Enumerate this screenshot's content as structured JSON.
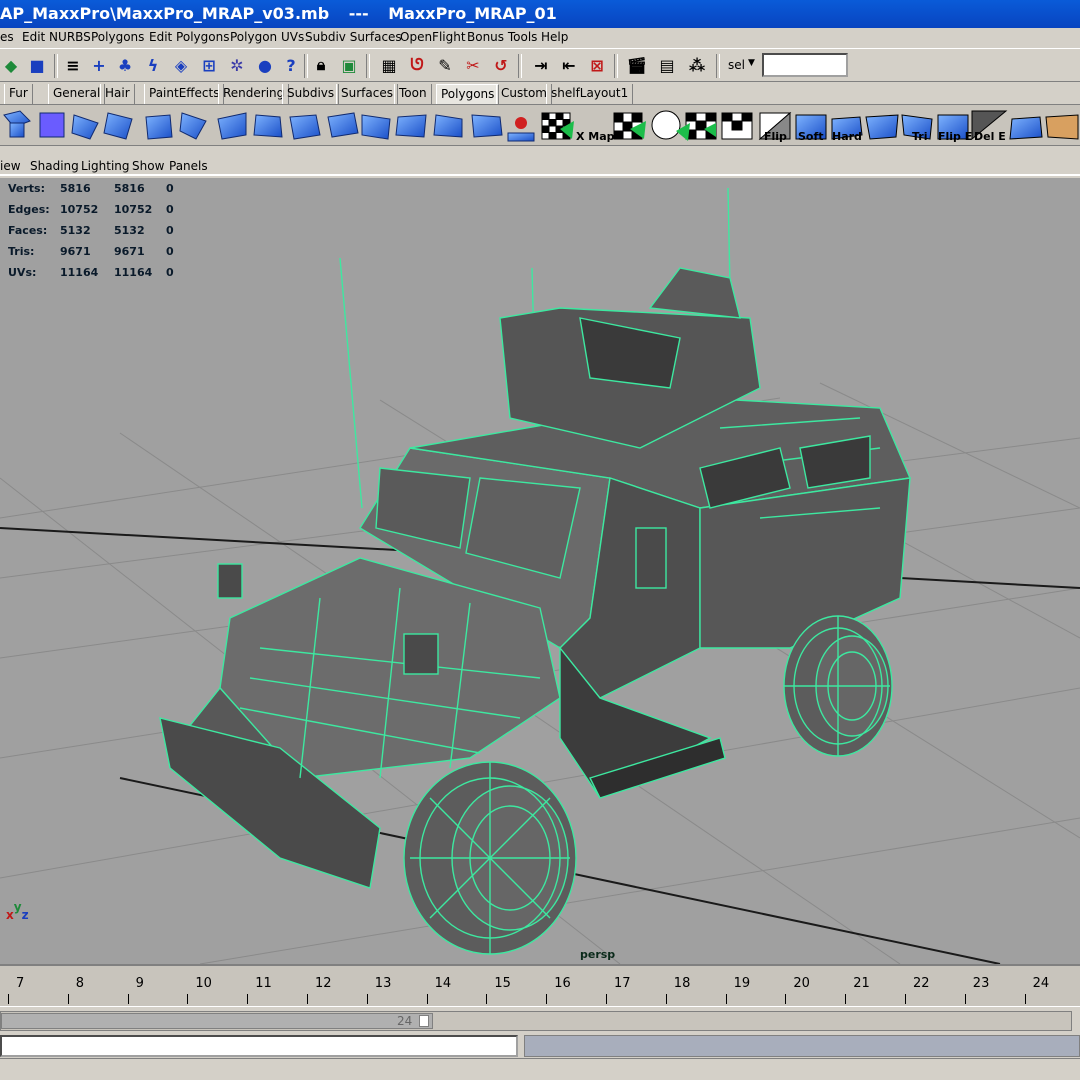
{
  "window": {
    "title_file": "AP_MaxxPro\\MaxxPro_MRAP_v03.mb",
    "title_sep": "---",
    "title_scene": "MaxxPro_MRAP_01"
  },
  "menubar": [
    "es",
    "Edit NURBS",
    "Polygons",
    "Edit Polygons",
    "Polygon UVs",
    "Subdiv Surfaces",
    "OpenFlight",
    "Bonus Tools",
    "Help"
  ],
  "statusline": {
    "sel_label": "sel",
    "sel_value": ""
  },
  "shelf_tabs": [
    "Fur",
    "General",
    "Hair",
    "PaintEffects",
    "Rendering",
    "Subdivs",
    "Surfaces",
    "Toon",
    "Polygons",
    "Custom",
    "shelfLayout1"
  ],
  "shelf_active_tab": "Polygons",
  "shelf_labels": {
    "xmap": "X Map",
    "flip": "Flip",
    "soft": "Soft",
    "hard": "Hard",
    "tri": "Tri",
    "flipe": "Flip E",
    "dele": "Del E"
  },
  "panel_menu": [
    "iew",
    "Shading",
    "Lighting",
    "Show",
    "Panels"
  ],
  "hud": {
    "rows": [
      {
        "label": "Verts:",
        "a": "5816",
        "b": "5816",
        "c": "0"
      },
      {
        "label": "Edges:",
        "a": "10752",
        "b": "10752",
        "c": "0"
      },
      {
        "label": "Faces:",
        "a": "5132",
        "b": "5132",
        "c": "0"
      },
      {
        "label": "Tris:",
        "a": "9671",
        "b": "9671",
        "c": "0"
      },
      {
        "label": "UVs:",
        "a": "11164",
        "b": "11164",
        "c": "0"
      }
    ]
  },
  "viewport": {
    "camera": "persp",
    "axis_x": "x",
    "axis_y": "y",
    "axis_z": "z",
    "wire_color": "#3de8a0",
    "bg_color": "#a0a0a0"
  },
  "timeline": {
    "frames": [
      "7",
      "8",
      "9",
      "10",
      "11",
      "12",
      "13",
      "14",
      "15",
      "16",
      "17",
      "18",
      "19",
      "20",
      "21",
      "22",
      "23",
      "24"
    ]
  },
  "range": {
    "end_value": "24"
  }
}
